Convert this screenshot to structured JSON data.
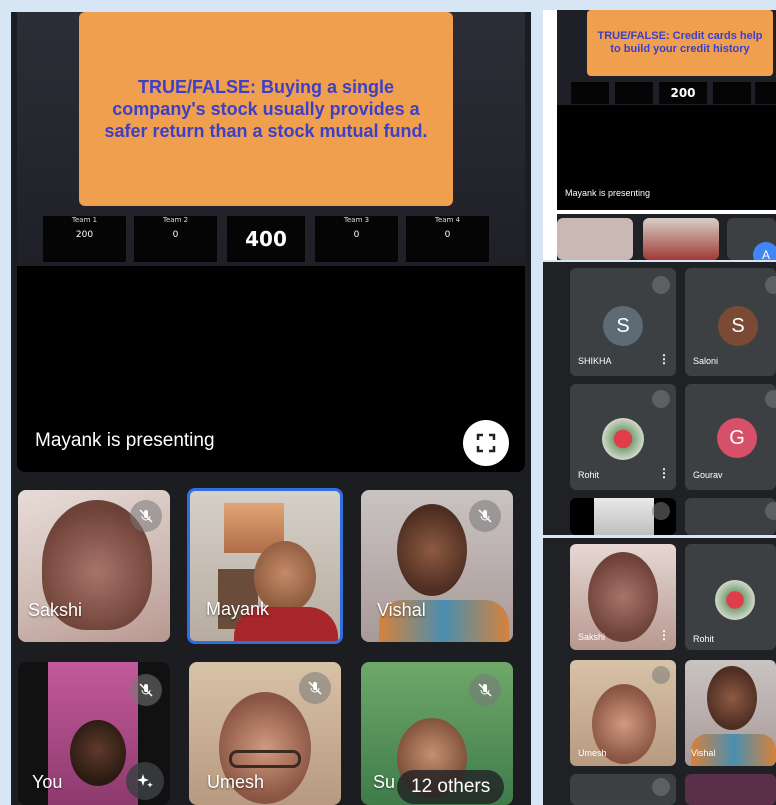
{
  "main": {
    "question": "TRUE/FALSE: Buying a single company's stock usually provides a safer return than a stock mutual fund.",
    "scores": [
      {
        "team": "Team 1",
        "value": "200"
      },
      {
        "team": "Team 2",
        "value": "0"
      },
      {
        "center": "400"
      },
      {
        "team": "Team 3",
        "value": "0"
      },
      {
        "team": "Team 4",
        "value": "0"
      }
    ],
    "presenting": "Mayank is presenting",
    "participants": [
      "Sakshi",
      "Mayank",
      "Vishal",
      "You",
      "Umesh",
      "Su"
    ],
    "others_label": "12 others"
  },
  "right_top": {
    "question": "TRUE/FALSE: Credit cards help to build your credit history",
    "center_score": "200",
    "presenting": "Mayank is presenting",
    "avatar_letter": "A"
  },
  "right_mid": {
    "tiles": [
      {
        "name": "SHIKHA",
        "letter": "S",
        "color": "#5f6b74"
      },
      {
        "name": "Saloni",
        "letter": "S",
        "color": "#7a4a35"
      },
      {
        "name": "Rohit",
        "letter": "",
        "color": ""
      },
      {
        "name": "Gourav",
        "letter": "G",
        "color": "#d6506a"
      }
    ]
  },
  "right_bottom": {
    "tiles": [
      "Sakshi",
      "Rohit",
      "Umesh",
      "Vishal"
    ]
  }
}
